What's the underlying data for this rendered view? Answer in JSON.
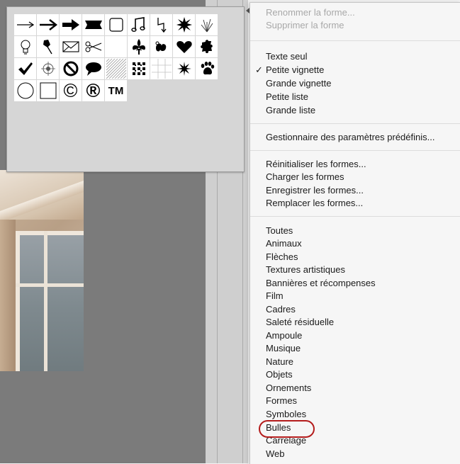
{
  "shape_panel": {
    "rows": [
      [
        "thin-arrow-icon",
        "arrow-icon",
        "bold-arrow-icon",
        "banner-icon",
        "frame-icon",
        "music-notes-icon",
        "lightning-icon",
        "starburst-icon",
        "grass-icon",
        ""
      ],
      [
        "lightbulb-icon",
        "thumbtack-icon",
        "envelope-icon",
        "scissors-icon",
        "blank-icon",
        "fleur-de-lis-icon",
        "ornament-icon",
        "heart-icon",
        "puzzle-icon",
        ""
      ],
      [
        "checkmark-icon",
        "target-icon",
        "no-sign-icon",
        "speech-bubble-icon",
        "diagonal-lines-icon",
        "dots-grid-icon",
        "tile-grid-icon",
        "splat-icon",
        "paw-print-icon",
        ""
      ],
      [
        "circle-icon",
        "square-icon",
        "copyright-icon",
        "registered-icon",
        "trademark-icon",
        "",
        "",
        "",
        "",
        ""
      ]
    ]
  },
  "menu": {
    "disabled_items": [
      "Renommer la forme...",
      "Supprimer la forme"
    ],
    "view_items": [
      "Texte seul",
      "Petite vignette",
      "Grande vignette",
      "Petite liste",
      "Grande liste"
    ],
    "checked_view": "✓",
    "preset_manager": "Gestionnaire des paramètres prédéfinis...",
    "file_items": [
      "Réinitialiser les formes...",
      "Charger les formes",
      "Enregistrer les formes...",
      "Remplacer les formes..."
    ],
    "libraries": [
      "Toutes",
      "Animaux",
      "Flèches",
      "Textures artistiques",
      "Bannières et récompenses",
      "Film",
      "Cadres",
      "Saleté résiduelle",
      "Ampoule",
      "Musique",
      "Nature",
      "Objets",
      "Ornements",
      "Formes",
      "Symboles",
      "Bulles",
      "Carrelage",
      "Web"
    ],
    "highlighted": "Bulles",
    "highlight_color": "#b41c1c"
  },
  "glyphs": {
    "copyright": "©",
    "registered": "®",
    "trademark": "TM"
  }
}
